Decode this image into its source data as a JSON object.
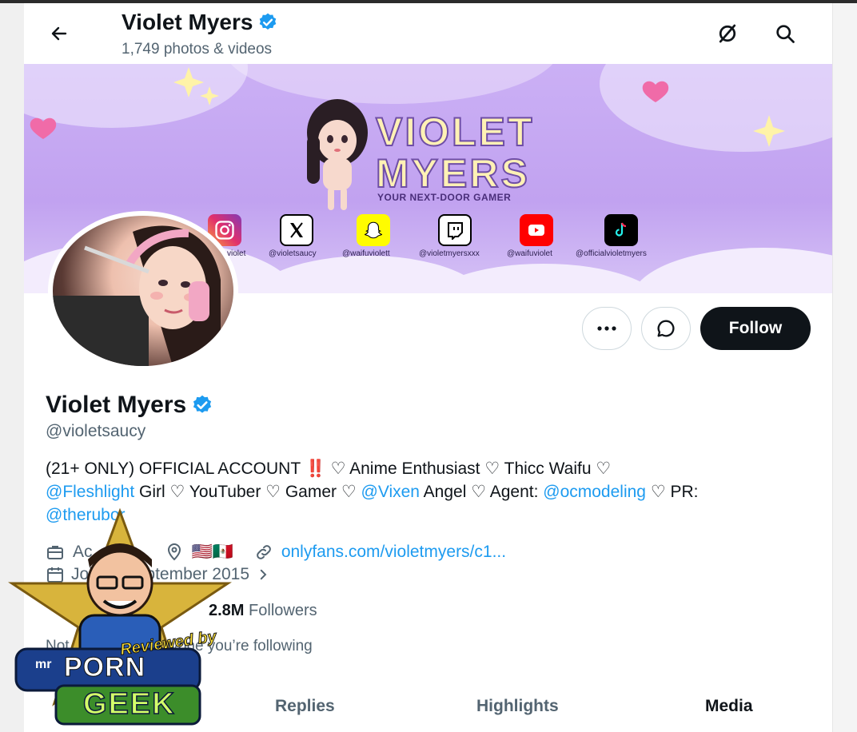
{
  "header": {
    "back_icon": "arrow-left-icon",
    "name": "Violet Myers",
    "sub": "1,749 photos & videos",
    "icons": [
      "grok-slash-icon",
      "search-icon"
    ]
  },
  "banner": {
    "title_line1": "VIOLET",
    "title_line2": "MYERS",
    "tagline": "YOUR NEXT-DOOR GAMER",
    "socials": [
      {
        "icon": "instagram-icon",
        "handle": "violet"
      },
      {
        "icon": "x-icon",
        "handle": "@violetsaucy"
      },
      {
        "icon": "snapchat-icon",
        "handle": "@waifuviolett"
      },
      {
        "icon": "twitch-icon",
        "handle": "@violetmyersxxx"
      },
      {
        "icon": "youtube-icon",
        "handle": "@waifuviolet"
      },
      {
        "icon": "tiktok-icon",
        "handle": "@officialvioletmyers"
      }
    ]
  },
  "actions": {
    "more_icon": "more-dots-icon",
    "message_icon": "message-icon",
    "follow_label": "Follow"
  },
  "profile": {
    "name": "Violet Myers",
    "handle": "@violetsaucy",
    "bio": {
      "p1": "(21+ ONLY) OFFICIAL ACCOUNT ",
      "bang": "‼️",
      "p2": " ♡ Anime Enthusiast ♡ Thicc Waifu ♡",
      "link1": "@Fleshlight",
      "p3": " Girl ♡ YouTuber ♡ Gamer ♡ ",
      "link2": "@Vixen",
      "p4": " Angel ♡ Agent: ",
      "link3": "@ocmodeling",
      "p5": " ♡ PR:",
      "link4": "@therubor"
    },
    "category": "Ac",
    "location_flags": "🇺🇸🇲🇽",
    "website": "onlyfans.com/violetmyers/c1...",
    "joined": "Joined September 2015",
    "followers_count": "2.8M",
    "followers_label": "Followers",
    "followed_by": "Not followed by anyone you’re following"
  },
  "tabs": [
    "Replies",
    "Highlights",
    "Media"
  ],
  "watermark": {
    "line1": "Reviewed by",
    "line2": "mr",
    "line3": "PORN",
    "line4": "GEEK"
  },
  "colors": {
    "accent": "#1d9bf0",
    "follow_bg": "#0f1419",
    "banner": "#c1a2f0"
  }
}
